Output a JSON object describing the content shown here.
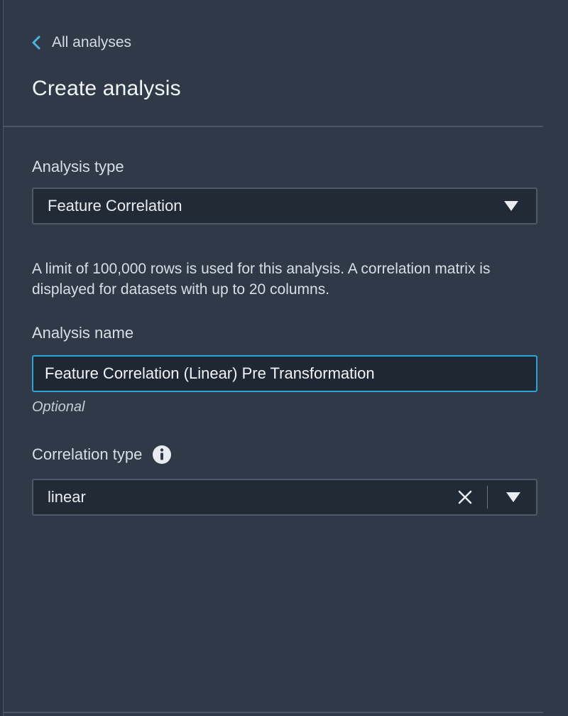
{
  "nav": {
    "back_label": "All analyses"
  },
  "page": {
    "title": "Create analysis"
  },
  "analysis_type": {
    "label": "Analysis type",
    "selected": "Feature Correlation"
  },
  "help_text": "A limit of 100,000 rows is used for this analysis. A correlation matrix is displayed for datasets with up to 20 columns.",
  "analysis_name": {
    "label": "Analysis name",
    "value": "Feature Correlation (Linear) Pre Transformation",
    "hint": "Optional"
  },
  "correlation_type": {
    "label": "Correlation type",
    "selected": "linear"
  },
  "colors": {
    "background": "#2f3947",
    "input_background": "#222a35",
    "focus_border": "#2aa4d6",
    "accent": "#4fb3d9"
  },
  "icons": {
    "back": "chevron-left-icon",
    "dropdown": "caret-down-icon",
    "info": "info-icon",
    "clear": "close-icon"
  }
}
